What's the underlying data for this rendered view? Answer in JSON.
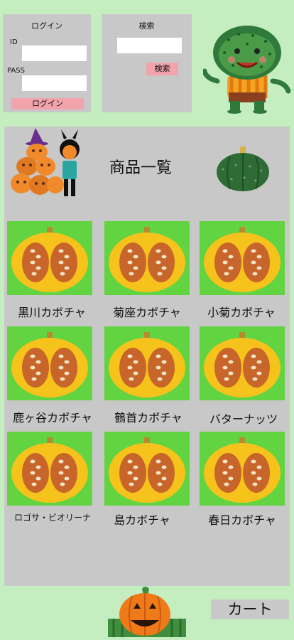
{
  "login": {
    "title": "ログイン",
    "id_label": "ID",
    "id_value": "",
    "pass_label": "PASS",
    "pass_value": "",
    "button": "ログイン"
  },
  "search": {
    "title": "検索",
    "value": "",
    "button": "検索"
  },
  "catalog": {
    "title": "商品一覧",
    "products": [
      {
        "name": "黒川カボチャ"
      },
      {
        "name": "菊座カボチャ"
      },
      {
        "name": "小菊カボチャ"
      },
      {
        "name": "鹿ヶ谷カボチャ"
      },
      {
        "name": "鶴首カボチャ"
      },
      {
        "name": "バターナッツ"
      },
      {
        "name": "ロゴサ・ビオリーナ"
      },
      {
        "name": "島カボチャ"
      },
      {
        "name": "春日カボチャ"
      }
    ]
  },
  "cart": {
    "label": "カート"
  },
  "colors": {
    "background": "#c5eec0",
    "panel": "#c8c8c8",
    "button_pink": "#f2a3ac",
    "tile_green": "#62d442"
  },
  "icons": [
    "green-ogre-mascot",
    "halloween-pumpkins-illustration",
    "green-kabocha-illustration",
    "pumpkin-half-image",
    "jack-o-lantern-mascot"
  ]
}
